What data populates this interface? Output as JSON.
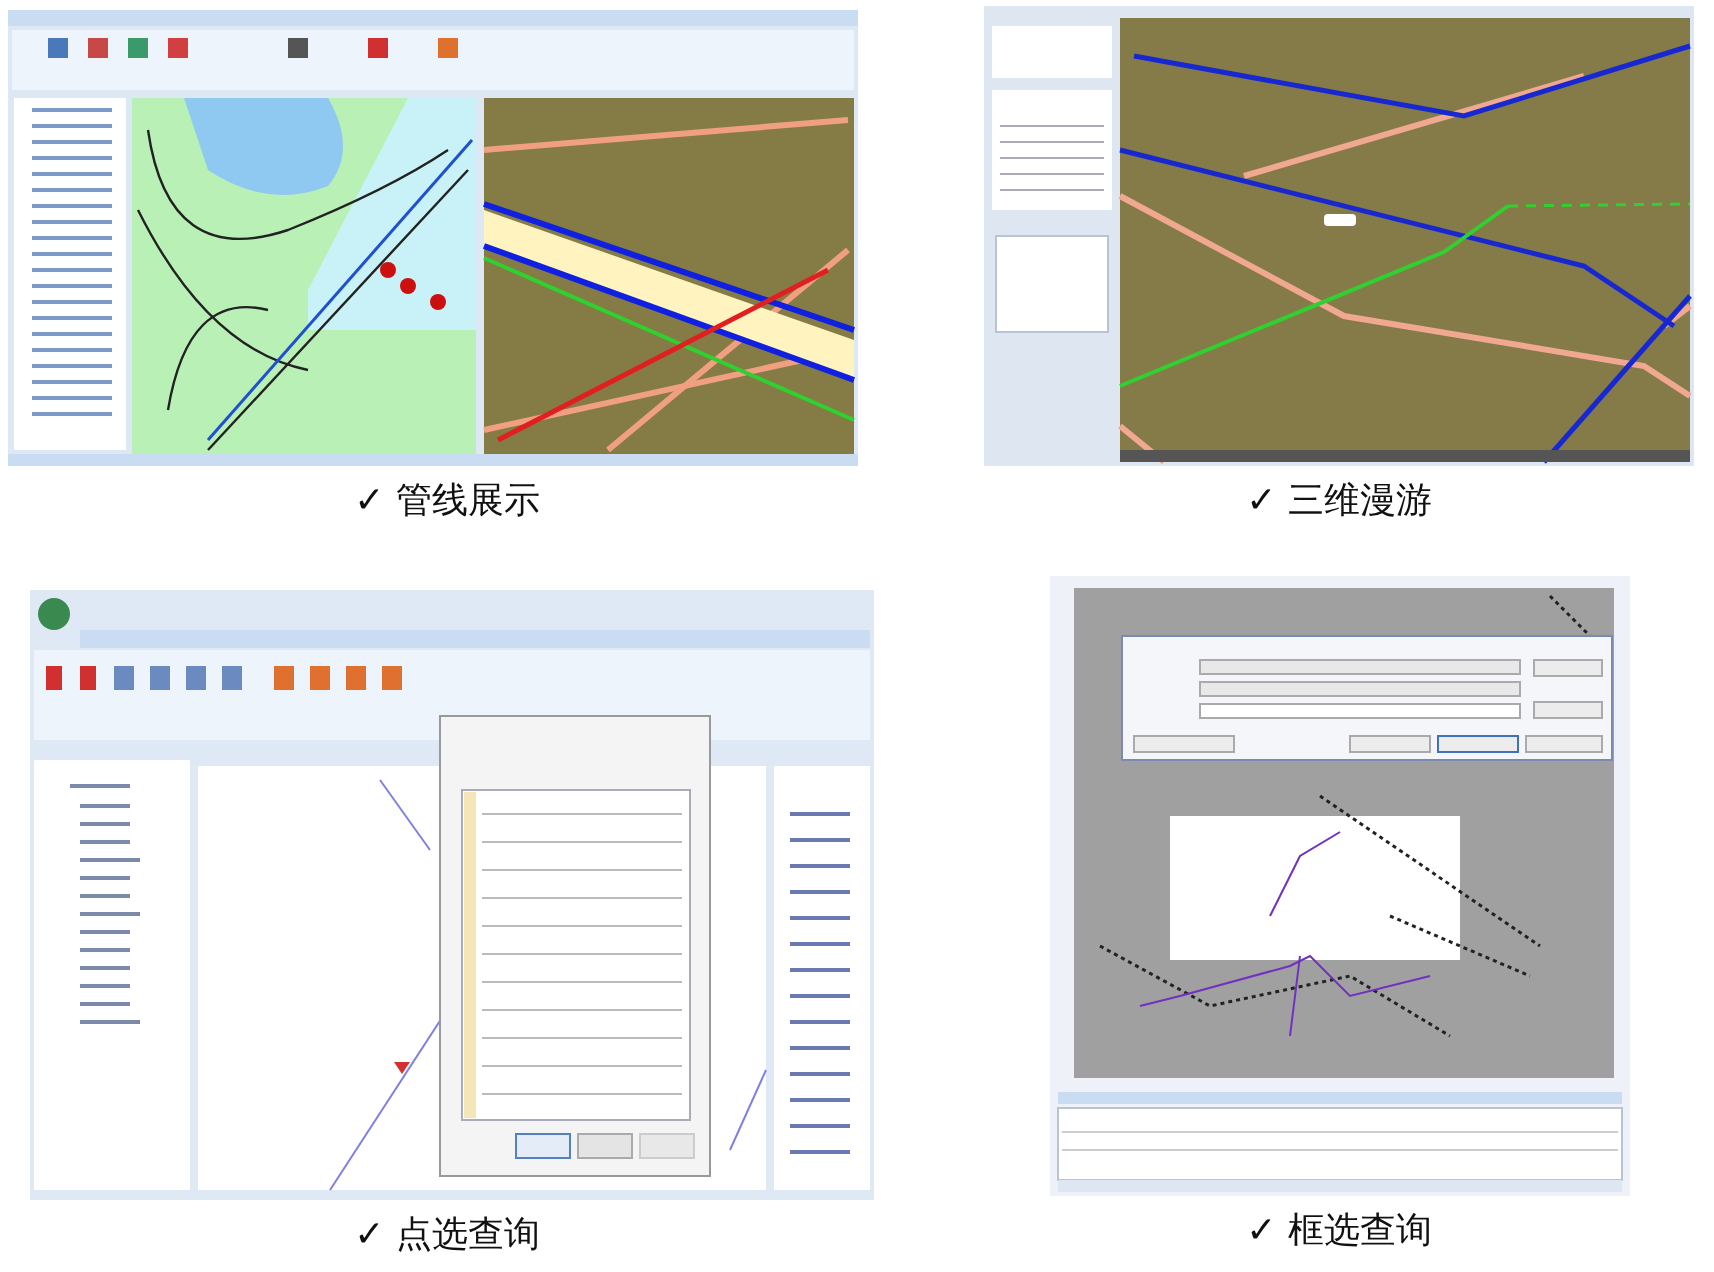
{
  "panels": [
    {
      "kind": "pipeline_display",
      "caption": "✓ 管线展示"
    },
    {
      "kind": "roaming_3d",
      "caption": "✓ 三维漫游"
    },
    {
      "kind": "point_query",
      "caption": "✓ 点选查询"
    },
    {
      "kind": "box_query",
      "caption": "✓ 框选查询"
    }
  ]
}
